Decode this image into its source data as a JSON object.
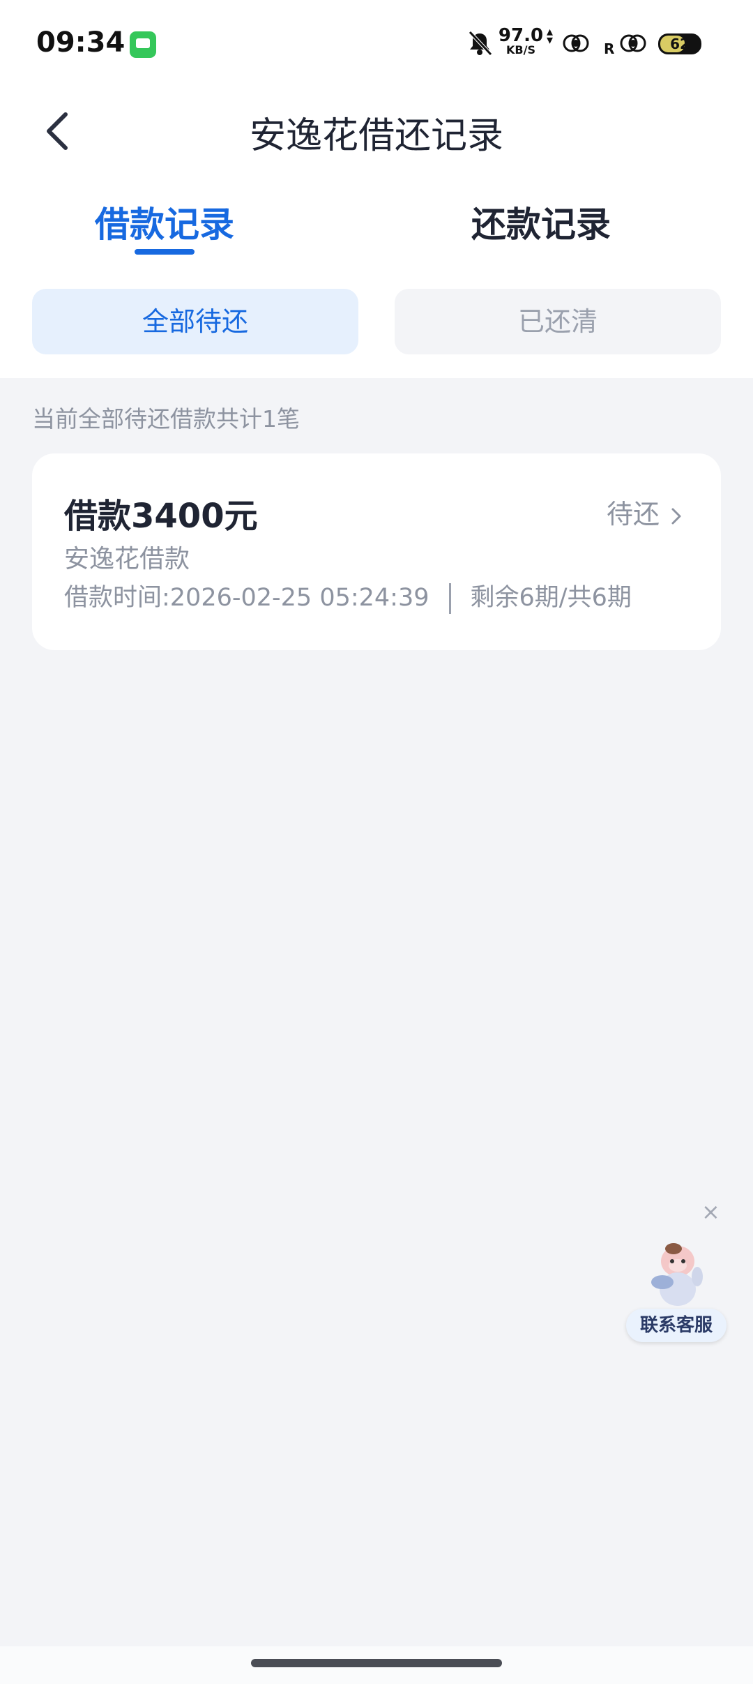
{
  "status_bar": {
    "time": "09:34",
    "net_speed_value": "97.0",
    "net_speed_unit": "KB/S",
    "roaming": "R",
    "battery": "62",
    "battery_level": 0.62
  },
  "header": {
    "title": "安逸花借还记录"
  },
  "tabs": [
    {
      "label": "借款记录",
      "active": true
    },
    {
      "label": "还款记录",
      "active": false
    }
  ],
  "filters": [
    {
      "label": "全部待还",
      "active": true
    },
    {
      "label": "已还清",
      "active": false
    }
  ],
  "summary": "当前全部待还借款共计1笔",
  "loan_card": {
    "amount": "借款3400元",
    "status": "待还",
    "product": "安逸花借款",
    "time": "借款时间:2026-02-25 05:24:39",
    "installments": "剩余6期/共6期"
  },
  "service": {
    "label": "联系客服",
    "close": "×"
  },
  "colors": {
    "accent": "#1769e0",
    "accent_bg": "#e6f0fd",
    "page_bg": "#f3f4f7",
    "muted_text": "#8d93a0"
  }
}
